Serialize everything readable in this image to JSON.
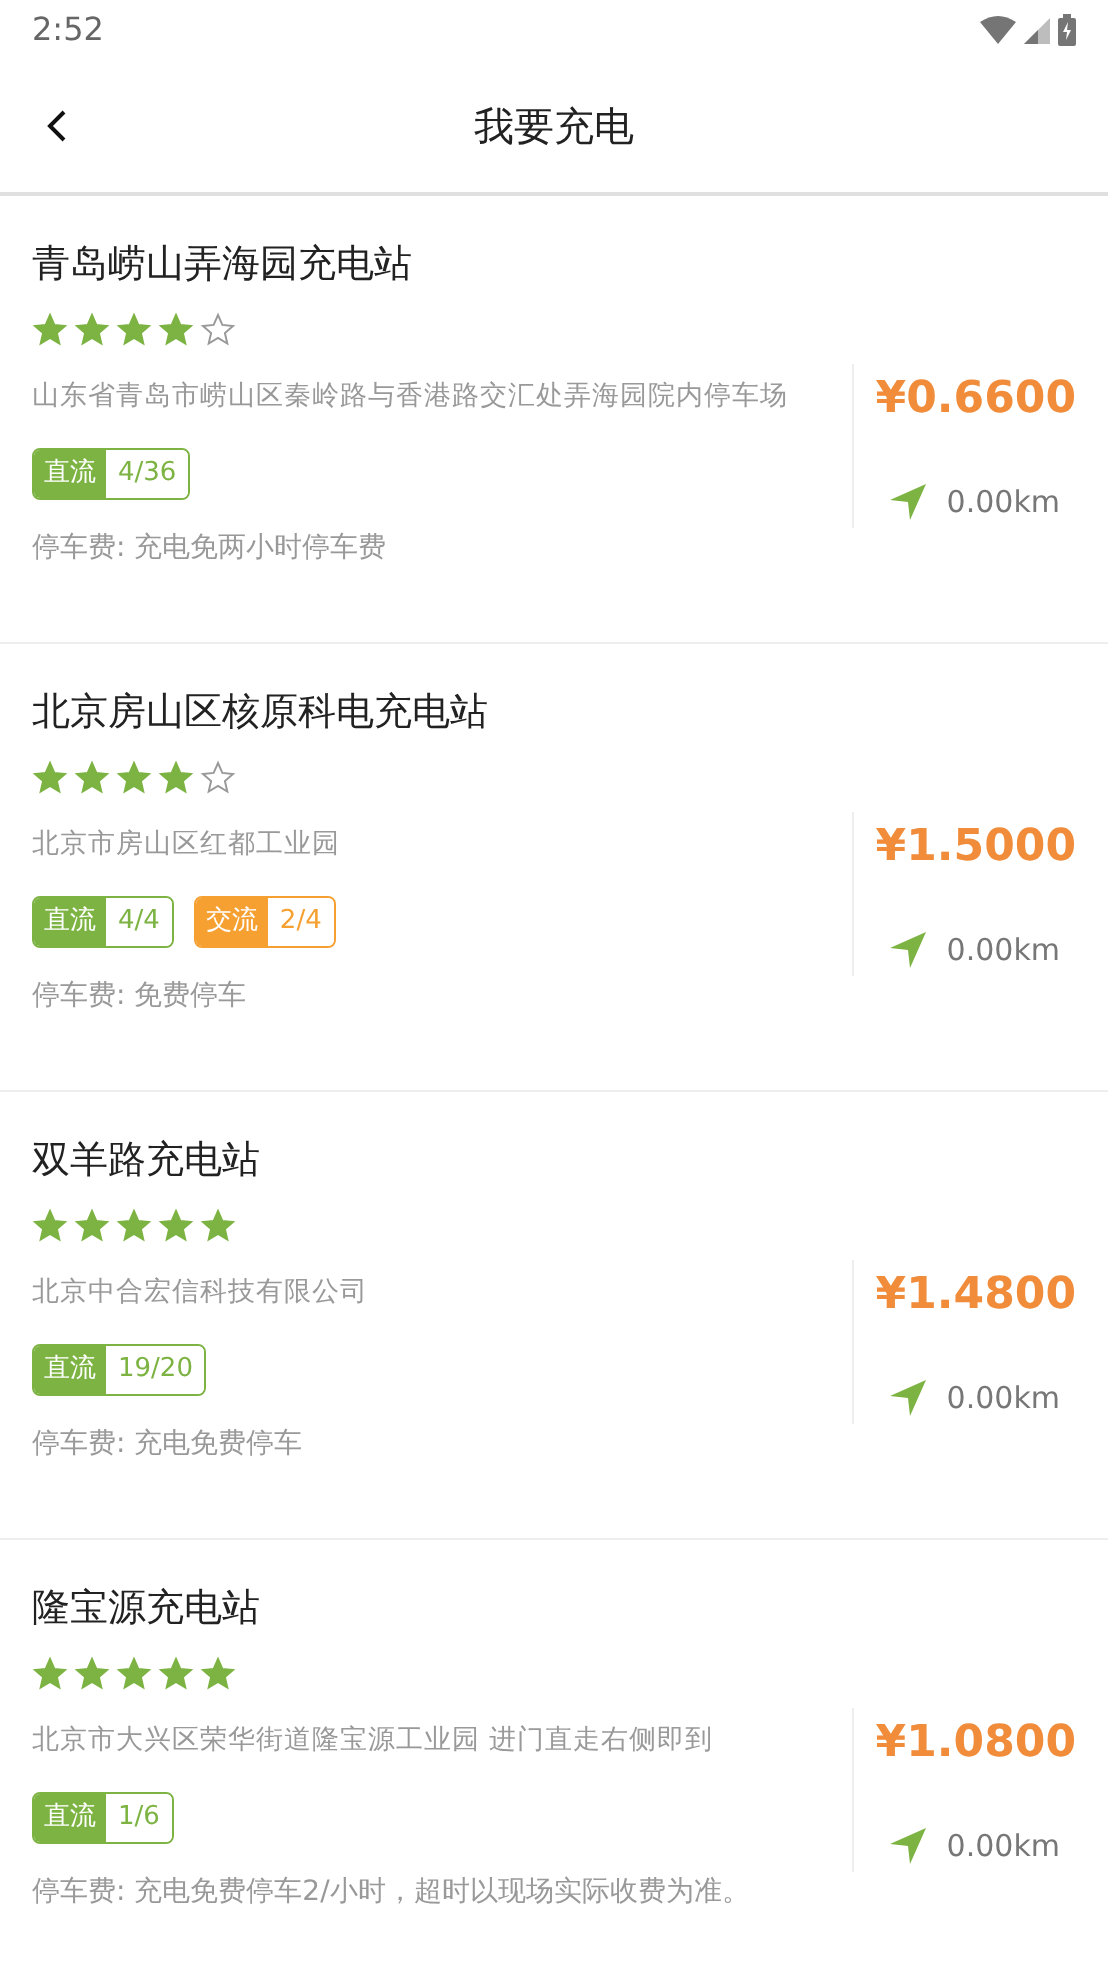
{
  "status_bar": {
    "time": "2:52"
  },
  "header": {
    "title": "我要充电"
  },
  "stations": [
    {
      "name": "青岛崂山弄海园充电站",
      "stars": 4,
      "address": "山东省青岛市崂山区秦岭路与香港路交汇处弄海园院内停车场",
      "price": "¥0.6600",
      "distance": "0.00km",
      "tags": [
        {
          "kind": "dc",
          "label": "直流",
          "count": "4/36"
        }
      ],
      "parking": "停车费: 充电免两小时停车费"
    },
    {
      "name": "北京房山区核原科电充电站",
      "stars": 4,
      "address": "北京市房山区红都工业园",
      "price": "¥1.5000",
      "distance": "0.00km",
      "tags": [
        {
          "kind": "dc",
          "label": "直流",
          "count": "4/4"
        },
        {
          "kind": "ac",
          "label": "交流",
          "count": "2/4"
        }
      ],
      "parking": "停车费: 免费停车"
    },
    {
      "name": "双羊路充电站",
      "stars": 5,
      "address": "北京中合宏信科技有限公司",
      "price": "¥1.4800",
      "distance": "0.00km",
      "tags": [
        {
          "kind": "dc",
          "label": "直流",
          "count": "19/20"
        }
      ],
      "parking": "停车费: 充电免费停车"
    },
    {
      "name": "隆宝源充电站",
      "stars": 5,
      "address": "北京市大兴区荣华街道隆宝源工业园 进门直走右侧即到",
      "price": "¥1.0800",
      "distance": "0.00km",
      "tags": [
        {
          "kind": "dc",
          "label": "直流",
          "count": "1/6"
        }
      ],
      "parking": "停车费: 充电免费停车2/小时，超时以现场实际收费为准。"
    }
  ]
}
